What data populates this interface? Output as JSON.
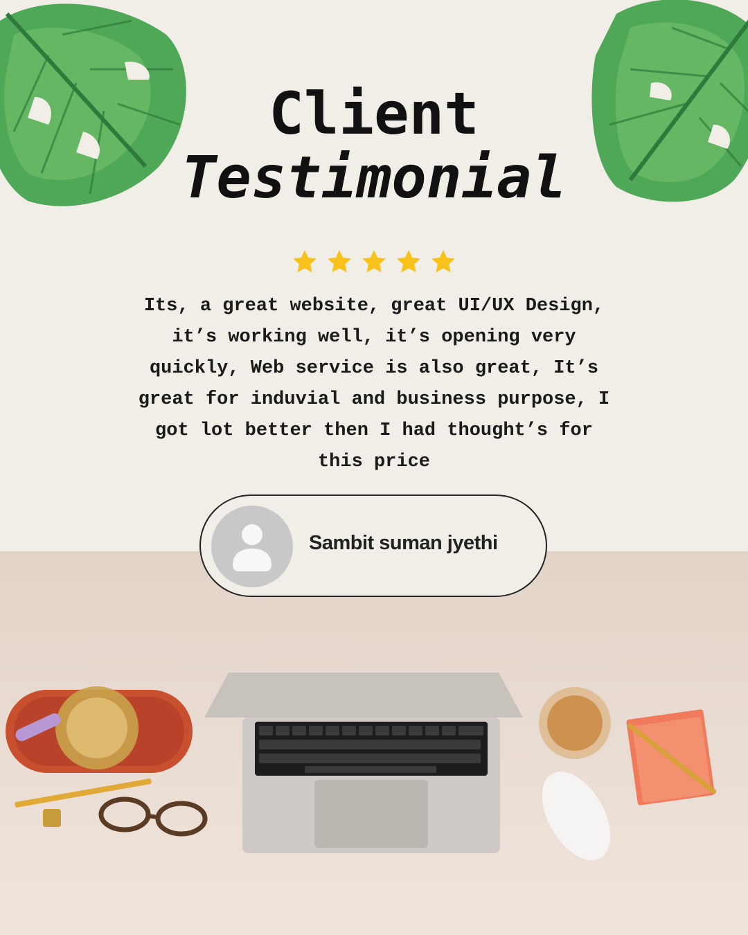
{
  "title": {
    "line1": "Client",
    "line2": "Testimonial"
  },
  "rating": {
    "stars_filled": 5,
    "stars_total": 5,
    "color": "#f8c21b"
  },
  "testimonial": {
    "text": "Its, a great website, great UI/UX Design,\nit’s working well, it’s opening very\nquickly, Web service is also great, It’s\ngreat for induvial and business purpose, I\ngot lot better then I had thought’s for\nthis price"
  },
  "client": {
    "name": "Sambit suman jyethi",
    "avatar_icon": "user-avatar-icon"
  },
  "decor": {
    "leaf_icon": "monstera-leaf-icon",
    "leaf_color": "#3f9a4a",
    "photo_description_icon": "desk-laptop-photo"
  }
}
